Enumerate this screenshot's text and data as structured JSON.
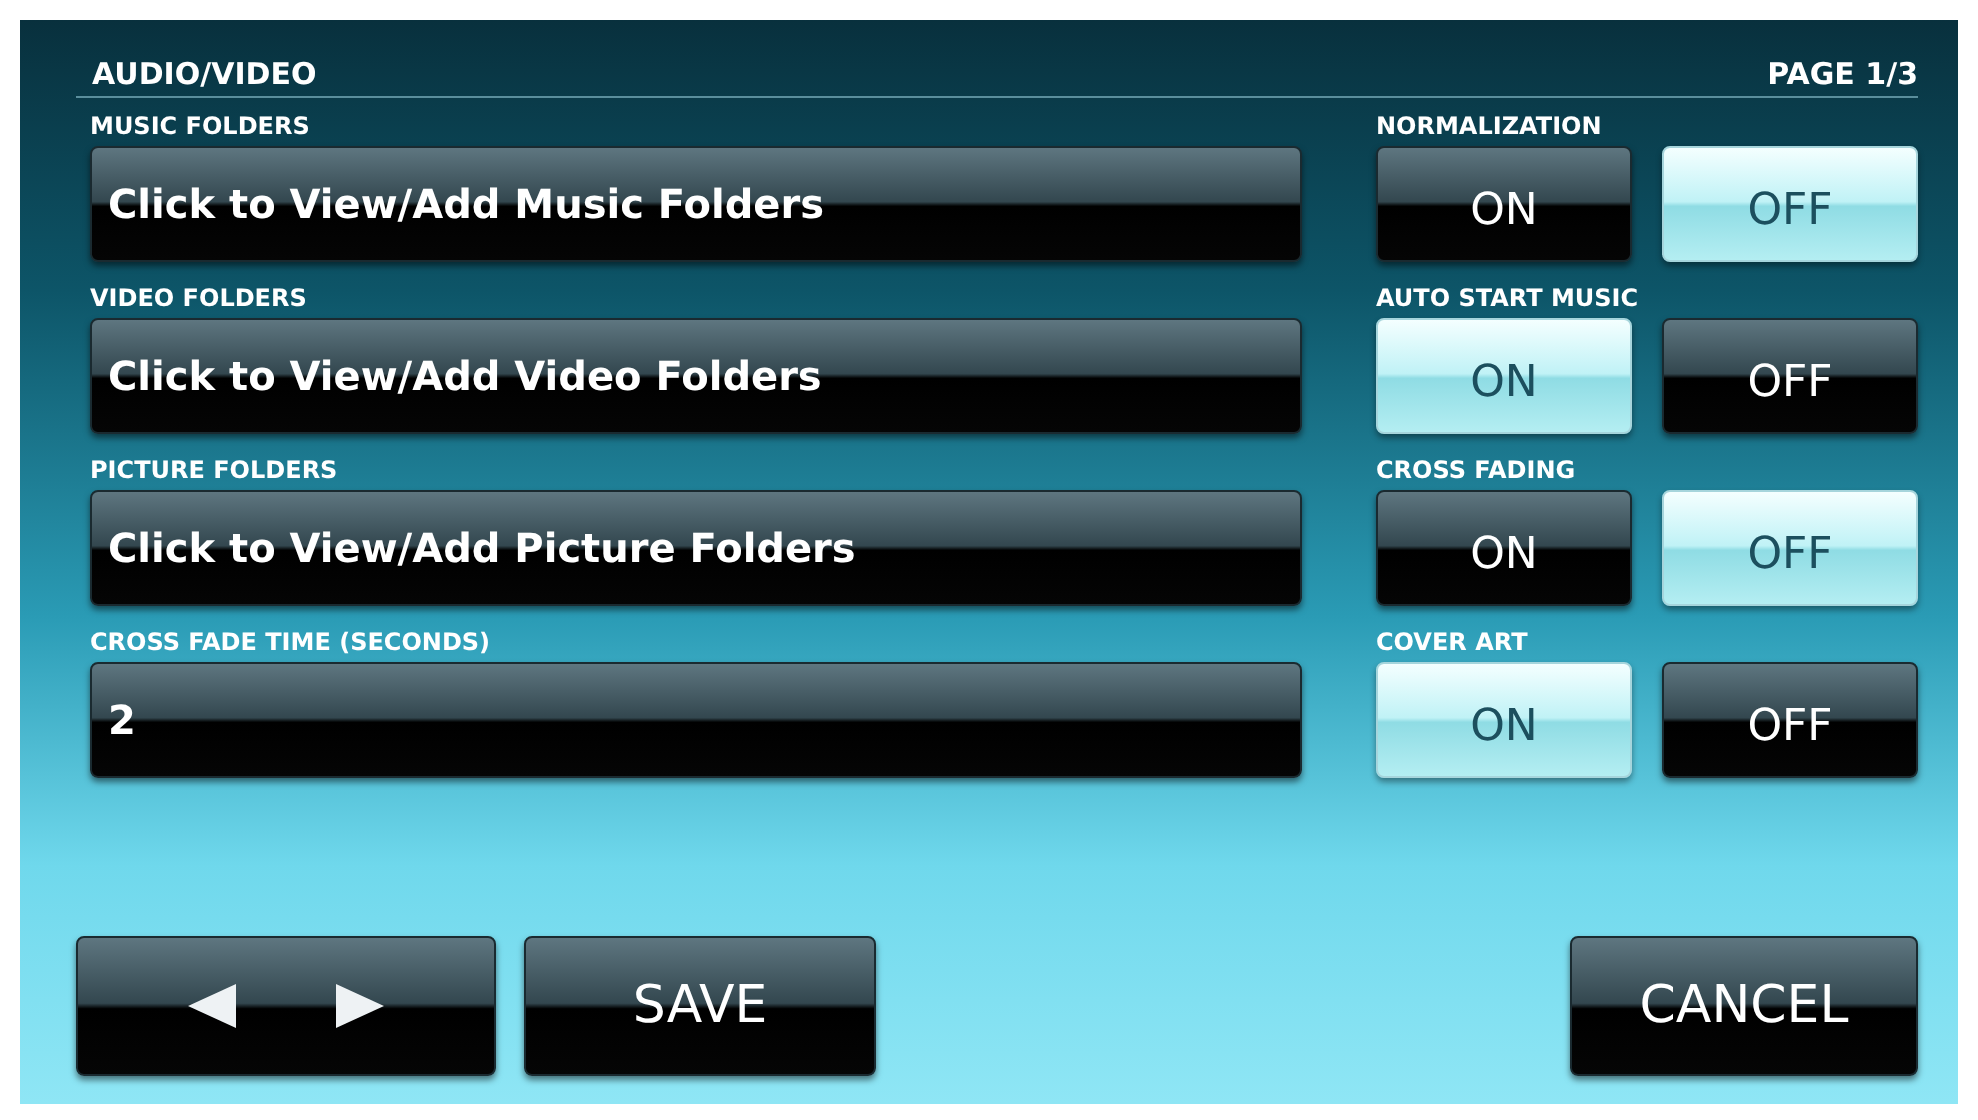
{
  "header": {
    "title": "AUDIO/VIDEO",
    "page": "PAGE 1/3"
  },
  "rows": [
    {
      "field": {
        "label": "MUSIC FOLDERS",
        "value": "Click to View/Add Music Folders"
      },
      "toggle": {
        "label": "NORMALIZATION",
        "options": [
          {
            "label": "ON",
            "selected": false
          },
          {
            "label": "OFF",
            "selected": true
          }
        ]
      }
    },
    {
      "field": {
        "label": "VIDEO FOLDERS",
        "value": "Click to View/Add Video Folders"
      },
      "toggle": {
        "label": "AUTO START MUSIC",
        "options": [
          {
            "label": "ON",
            "selected": true
          },
          {
            "label": "OFF",
            "selected": false
          }
        ]
      }
    },
    {
      "field": {
        "label": "PICTURE FOLDERS",
        "value": "Click to View/Add Picture Folders"
      },
      "toggle": {
        "label": "CROSS FADING",
        "options": [
          {
            "label": "ON",
            "selected": false
          },
          {
            "label": "OFF",
            "selected": true
          }
        ]
      }
    },
    {
      "field": {
        "label": "CROSS FADE TIME (SECONDS)",
        "value": "2"
      },
      "toggle": {
        "label": "COVER ART",
        "options": [
          {
            "label": "ON",
            "selected": true
          },
          {
            "label": "OFF",
            "selected": false
          }
        ]
      }
    }
  ],
  "footer": {
    "save": "SAVE",
    "cancel": "CANCEL"
  }
}
